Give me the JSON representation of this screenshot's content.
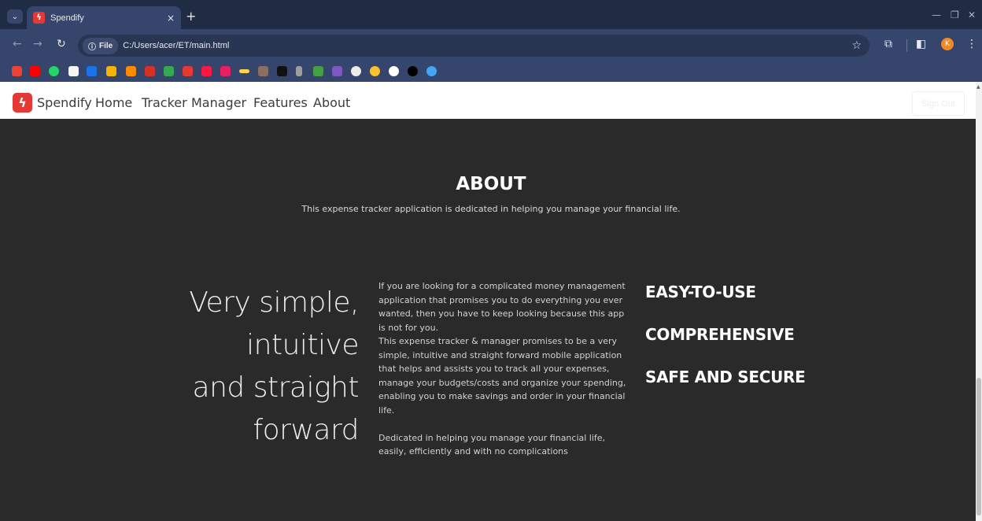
{
  "browser": {
    "tab_title": "Spendify",
    "tab_favicon": "spendify-bolt-icon",
    "tab_close": "×",
    "new_tab": "+",
    "chip_label": "File",
    "url": "C:/Users/acer/ET/main.html",
    "profile_initial": "K"
  },
  "nav": {
    "brand": "Spendify",
    "links": [
      "Home",
      "Tracker",
      "Manager",
      "Features",
      "About"
    ],
    "signout": "Sign Out"
  },
  "about": {
    "title": "ABOUT",
    "subtitle": "This expense tracker application is dedicated in helping you manage your financial life.",
    "headline_lines": [
      "Very simple,",
      "intuitive",
      "and straight",
      "forward"
    ],
    "desc_p1": "If you are looking for a complicated money management application that promises you to do everything you ever wanted, then you have to keep looking because this app is not for you.",
    "desc_p2": "This expense tracker & manager promises to be a very simple, intuitive and straight forward mobile application that helps and assists you to track all your expenses, manage your budgets/costs and organize your spending, enabling you to make savings and order in your financial life.",
    "desc_p3": "Dedicated in helping you manage your financial life, easily, efficiently and with no complications",
    "features": [
      "EASY-TO-USE",
      "COMPREHENSIVE",
      "SAFE AND SECURE"
    ]
  },
  "colors": {
    "accent": "#e53935",
    "chrome": "#35456b",
    "content_bg": "#2a2a2a"
  }
}
